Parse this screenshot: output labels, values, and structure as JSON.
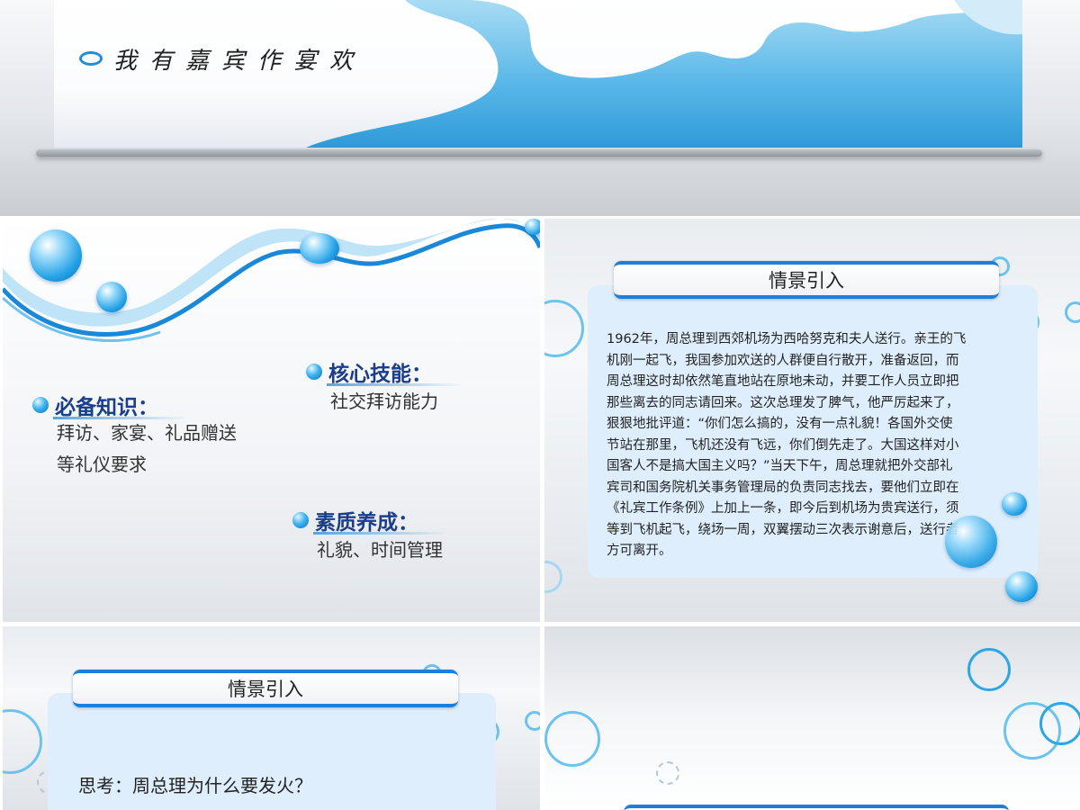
{
  "slides": {
    "cover": {
      "title": "我有嘉宾作宴欢"
    },
    "outline": {
      "knowledge": {
        "heading": "必备知识：",
        "lines": [
          "拜访、家宴、礼品赠送",
          "等礼仪要求"
        ]
      },
      "skill": {
        "heading": "核心技能：",
        "lines": [
          "社交拜访能力"
        ]
      },
      "quality": {
        "heading": "素质养成：",
        "lines": [
          "礼貌、时间管理"
        ]
      }
    },
    "scenario1": {
      "title": "情景引入",
      "lines": [
        "1962年，周总理到西郊机场为西哈努克和夫人送行。亲王的飞",
        "机刚一起飞，我国参加欢送的人群便自行散开，准备返回，而",
        "周总理这时却依然笔直地站在原地未动，并要工作人员立即把",
        "那些离去的同志请回来。这次总理发了脾气，他严厉起来了，",
        "狠狠地批评道：“你们怎么搞的，没有一点礼貌！各国外交使",
        "节站在那里，飞机还没有飞远，你们倒先走了。大国这样对小",
        "国客人不是搞大国主义吗？”当天下午，周总理就把外交部礼",
        "宾司和国务院机关事务管理局的负责同志找去，要他们立即在",
        "《礼宾工作条例》上加上一条，即今后到机场为贵宾送行，须",
        "等到飞机起飞，绕场一周，双翼摆动三次表示谢意后，送行者",
        "方可离开。"
      ]
    },
    "scenario2": {
      "title": "情景引入",
      "question": "思考：周总理为什么要发火？"
    }
  },
  "colors": {
    "accent_blue": "#1d7fd9",
    "heading_navy": "#1a3e8a",
    "box_light_blue": "#dfeefc"
  }
}
